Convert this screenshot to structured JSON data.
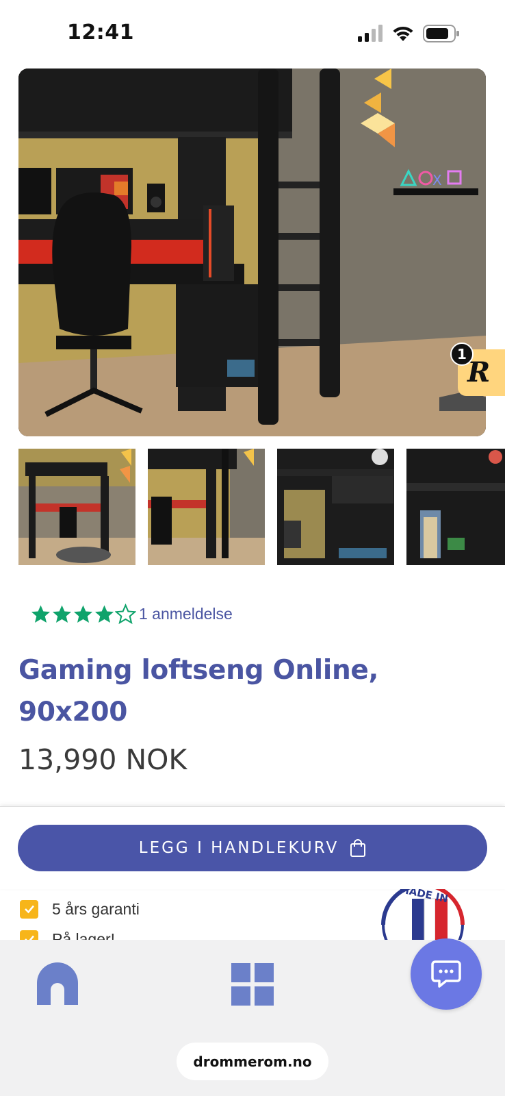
{
  "status_bar": {
    "time": "12:41",
    "icons": [
      "cellular-signal-icon",
      "wifi-icon",
      "battery-icon"
    ]
  },
  "product": {
    "gallery": {
      "hero_image": "loft-bed-gaming-photo",
      "thumbnails": [
        "thumbnail-1",
        "thumbnail-2",
        "thumbnail-3",
        "thumbnail-4"
      ],
      "rewards_count": "1",
      "rewards_icon": "rewards-r-icon"
    },
    "rating": {
      "stars_filled": 4,
      "stars_total": 5,
      "review_text": "1 anmeldelse"
    },
    "title": "Gaming loftseng Online, 90x200",
    "price": "13,990 NOK"
  },
  "cart": {
    "add_to_cart_label": "LEGG I HANDLEKURV",
    "icon": "shopping-bag-icon"
  },
  "features": [
    {
      "text": "5 års garanti"
    },
    {
      "text": "På lager!"
    }
  ],
  "badge": {
    "text": "MADE IN"
  },
  "bottom_nav": {
    "items": [
      "home-icon",
      "grid-icon"
    ],
    "chat_icon": "chat-icon"
  },
  "browser": {
    "url": "drommerom.no"
  },
  "colors": {
    "accent": "#4a55a8",
    "title": "#4a55a2",
    "star": "#0fa36b",
    "check": "#f7b51a",
    "chat": "#6b78e4",
    "rewards": "#ffd57e"
  }
}
